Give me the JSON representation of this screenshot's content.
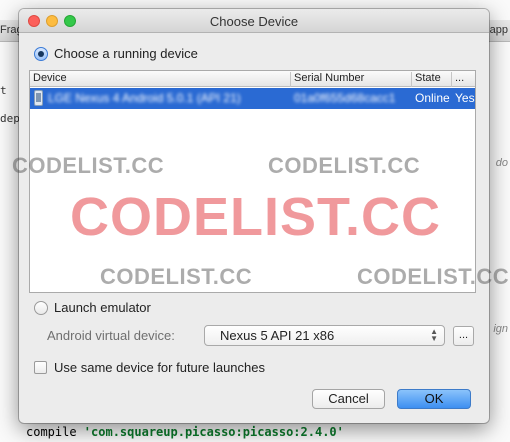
{
  "background": {
    "tab_left": "Frag",
    "tab_right": "app",
    "left_frag_1": "t",
    "left_frag_2": "dep",
    "right_frag_1": "do",
    "right_frag_2": "ign",
    "code_prefix": "compile ",
    "code_string": "'com.squareup.picasso:picasso:2.4.0'"
  },
  "dialog": {
    "title": "Choose Device",
    "running_option_label": "Choose a running device",
    "table": {
      "columns": [
        "Device",
        "Serial Number",
        "State",
        "..."
      ],
      "rows": [
        {
          "device": "LGE Nexus 4 Android 5.0.1 (API 21)",
          "serial": "01a0f655d68cacc1",
          "state": "Online",
          "extra": "Yes"
        }
      ]
    },
    "launch_option_label": "Launch emulator",
    "avd_label": "Android virtual device:",
    "avd_selected": "Nexus 5 API 21 x86",
    "browse_label": "...",
    "same_device_label": "Use same device for future launches",
    "cancel_label": "Cancel",
    "ok_label": "OK"
  },
  "watermark": {
    "small_text": "CODELIST.CC",
    "big_text": "CODELIST.CC"
  },
  "colors": {
    "selection": "#2a6ad3",
    "watermark_red": "#e65a5f",
    "ok_button": "#3d8ff1"
  }
}
